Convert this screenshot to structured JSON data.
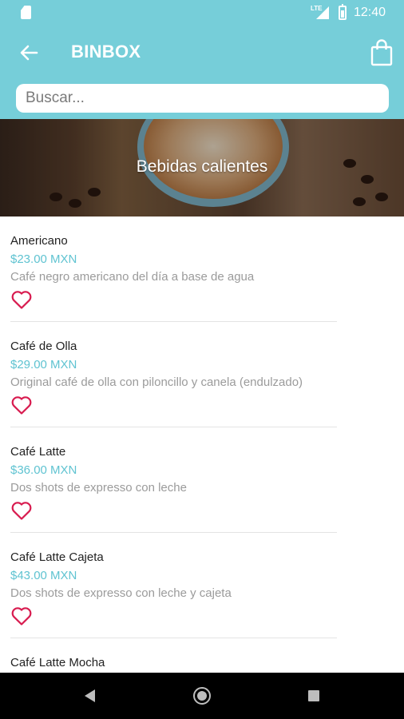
{
  "status_bar": {
    "network": "LTE",
    "time": "12:40"
  },
  "app_bar": {
    "title": "BINBOX"
  },
  "search": {
    "placeholder": "Buscar..."
  },
  "banner": {
    "title": "Bebidas calientes"
  },
  "products": [
    {
      "name": "Americano",
      "price": "$23.00 MXN",
      "description": "Café negro americano del día a base de agua"
    },
    {
      "name": "Café de Olla",
      "price": "$29.00 MXN",
      "description": "Original café de olla con piloncillo y canela (endulzado)"
    },
    {
      "name": "Café Latte",
      "price": "$36.00 MXN",
      "description": "Dos shots de expresso con leche"
    },
    {
      "name": "Café Latte Cajeta",
      "price": "$43.00 MXN",
      "description": "Dos shots de expresso con leche y cajeta"
    },
    {
      "name": "Café Latte Mocha",
      "price": "",
      "description": ""
    }
  ],
  "theme": {
    "primary": "#76ced9",
    "price_color": "#5fc3d1",
    "favorite_color": "#d81b4f"
  },
  "icons": {
    "back": "arrow-left-icon",
    "cart": "shopping-bag-icon",
    "favorite": "heart-outline-icon"
  }
}
